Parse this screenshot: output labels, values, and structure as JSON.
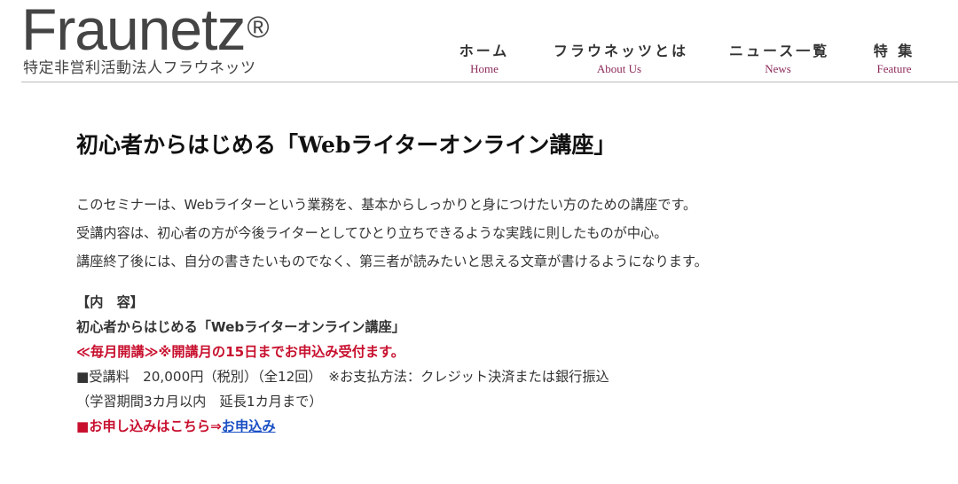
{
  "brand": {
    "name": "Fraunetz",
    "registered_mark": "®",
    "subtitle": "特定非営利活動法人フラウネッツ"
  },
  "nav": {
    "items": [
      {
        "jp": "ホーム",
        "en": "Home"
      },
      {
        "jp": "フラウネッツとは",
        "en": "About Us"
      },
      {
        "jp": "ニュース一覧",
        "en": "News"
      },
      {
        "jp": "特 集",
        "en": "Feature"
      }
    ]
  },
  "colors": {
    "nav_en": "#8c2a5a",
    "highlight_red": "#c8102e",
    "link_blue": "#1a4fc4"
  },
  "main": {
    "title": "初心者からはじめる「Webライターオンライン講座」",
    "intro": [
      "このセミナーは、Webライターという業務を、基本からしっかりと身につけたい方のための講座です。",
      "受講内容は、初心者の方が今後ライターとしてひとり立ちできるような実践に則したものが中心。",
      "講座終了後には、自分の書きたいものでなく、第三者が読みたいと思える文章が書けるようになります。"
    ],
    "content_heading": "【内　容】",
    "course_name": "初心者からはじめる「Webライターオンライン講座」",
    "notice": "≪毎月開講≫※開講月の15日までお申込み受付ます。",
    "fee": "■受講料　20,000円（税別）（全12回）　※お支払方法：クレジット決済または銀行振込",
    "period": "（学習期間3カ月以内　延長1カ月まで）",
    "apply_prefix": "■お申し込みはこちら⇒",
    "apply_link": "お申込み"
  }
}
